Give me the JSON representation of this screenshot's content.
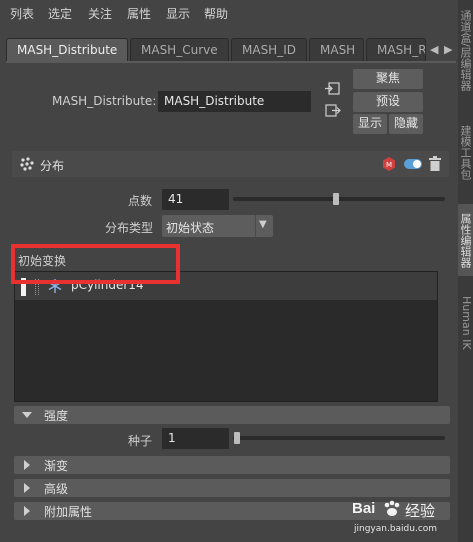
{
  "menu": [
    "列表",
    "选定",
    "关注",
    "属性",
    "显示",
    "帮助"
  ],
  "tabs": [
    "MASH_Distribute",
    "MASH_Curve",
    "MASH_ID",
    "MASH",
    "MASH_R"
  ],
  "node": {
    "label": "MASH_Distribute:",
    "value": "MASH_Distribute",
    "btn_focus": "聚焦",
    "btn_preset": "预设",
    "btn_show": "显示",
    "btn_hide": "隐藏"
  },
  "distribute": {
    "title": "分布",
    "points_label": "点数",
    "points_value": "41",
    "points_fraction": 0.47,
    "type_label": "分布类型",
    "type_value": "初始状态"
  },
  "initial_transform": {
    "label": "初始变换",
    "item": "pCylinder14"
  },
  "strength": {
    "title": "强度",
    "seed_label": "种子",
    "seed_value": "1",
    "seed_fraction": 0.0
  },
  "sections": [
    "渐变",
    "高级",
    "附加属性"
  ],
  "right_tabs": [
    "通道盒/层编辑器",
    "建模工具包",
    "属性编辑器",
    "Human IK"
  ],
  "watermark": {
    "brand": "Bai",
    "brand2": "经验",
    "url": "jingyan.baidu.com"
  },
  "colors": {
    "background": "#444444",
    "highlight_box": "#e83232",
    "toggle": "#5aa0d8",
    "mash_icon": "#d04040"
  }
}
